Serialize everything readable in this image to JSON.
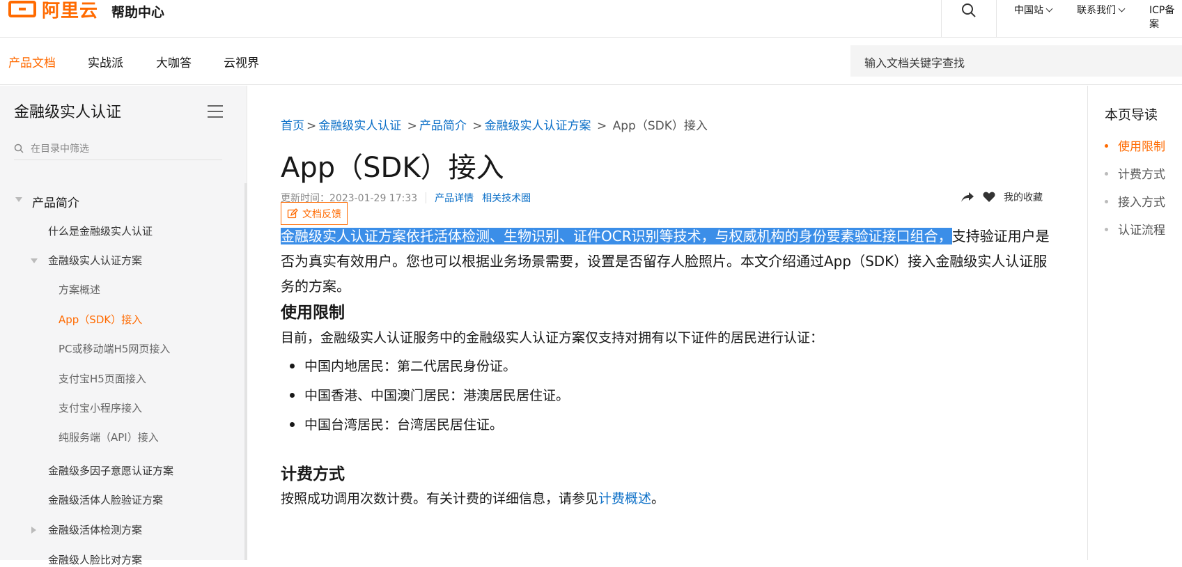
{
  "header": {
    "logo_text": "阿里云",
    "help_center": "帮助中心",
    "links": [
      "中国站",
      "联系我们",
      "ICP备案"
    ]
  },
  "nav": {
    "tabs": [
      "产品文档",
      "实战派",
      "大咖答",
      "云视界"
    ],
    "search_placeholder": "输入文档关键字查找"
  },
  "sidebar": {
    "title": "金融级实人认证",
    "filter_placeholder": "在目录中筛选",
    "items": [
      {
        "label": "产品简介"
      },
      {
        "label": "什么是金融级实人认证"
      },
      {
        "label": "金融级实人认证方案"
      },
      {
        "label": "方案概述"
      },
      {
        "label": "App（SDK）接入"
      },
      {
        "label": "PC或移动端H5网页接入"
      },
      {
        "label": "支付宝H5页面接入"
      },
      {
        "label": "支付宝小程序接入"
      },
      {
        "label": "纯服务端（API）接入"
      },
      {
        "label": "金融级多因子意愿认证方案"
      },
      {
        "label": "金融级活体人脸验证方案"
      },
      {
        "label": "金融级活体检测方案"
      },
      {
        "label": "金融级人脸比对方案"
      }
    ]
  },
  "breadcrumb": [
    "首页",
    "金融级实人认证",
    "产品简介",
    "金融级实人认证方案",
    "App（SDK）接入"
  ],
  "page_title": "App（SDK）接入",
  "meta": {
    "updated": "更新时间：2023-01-29 17:33",
    "product_detail": "产品详情",
    "tech_circle": "相关技术圈",
    "feedback": "文档反馈",
    "favorite": "我的收藏"
  },
  "intro": {
    "highlighted": "金融级实人认证方案依托活体检测、生物识别、证件OCR识别等技术，与权威机构的身份要素验证接口组合，",
    "rest": "支持验证用户是否为真实有效用户。您也可以根据业务场景需要，设置是否留存人脸照片。本文介绍通过App（SDK）接入金融级实人认证服务的方案。"
  },
  "section1": {
    "heading": "使用限制",
    "text": "目前，金融级实人认证服务中的金融级实人认证方案仅支持对拥有以下证件的居民进行认证：",
    "bullets": [
      "中国内地居民：第二代居民身份证。",
      "中国香港、中国澳门居民：港澳居民居住证。",
      "中国台湾居民：台湾居民居住证。"
    ]
  },
  "section2": {
    "heading": "计费方式",
    "text_before": "按照成功调用次数计费。有关计费的详细信息，请参见",
    "link": "计费概述",
    "text_after": "。"
  },
  "toc": {
    "title": "本页导读",
    "items": [
      "使用限制",
      "计费方式",
      "接入方式",
      "认证流程"
    ]
  },
  "colors": {
    "accent": "#ff6a00",
    "link": "#0b6fc7",
    "highlight": "#3b8ee8"
  }
}
